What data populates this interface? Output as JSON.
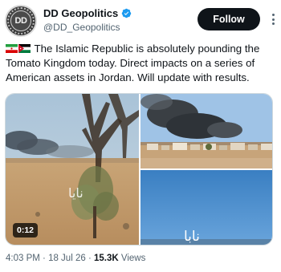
{
  "author": {
    "display_name": "DD Geopolitics",
    "handle": "@DD_Geopolitics",
    "avatar_text": "DD",
    "verified": true
  },
  "follow_label": "Follow",
  "tweet": {
    "flags": [
      "iran-flag-emoji",
      "jordan-flag-emoji"
    ],
    "text": "The Islamic Republic is absolutely pounding the Tomato Kingdom today. Direct impacts on a series of American assets in Jordan. Will update with results."
  },
  "media": {
    "video_timer": "0:12",
    "overlay_text_left": "نايا",
    "overlay_text_br": "نابا"
  },
  "meta": {
    "time": "4:03 PM",
    "date": "18 Jul 26",
    "views_count": "15.3K",
    "views_label": "Views"
  },
  "colors": {
    "follow_bg": "#0f1419",
    "verified_blue": "#1d9bf0",
    "secondary_text": "#536471"
  }
}
